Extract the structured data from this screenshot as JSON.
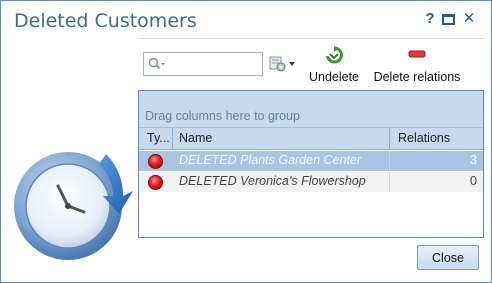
{
  "window": {
    "title": "Deleted Customers",
    "help_glyph": "?",
    "close_glyph": "✕"
  },
  "toolbar": {
    "search_value": "",
    "search_placeholder": "",
    "undelete_label": "Undelete",
    "delete_relations_label": "Delete relations"
  },
  "grid": {
    "group_panel_text": "Drag columns here to group",
    "columns": [
      "Ty...",
      "Name",
      "Relations"
    ],
    "rows": [
      {
        "type": "red-circle-icon",
        "name": "DELETED Plants Garden Center",
        "relations": "3",
        "selected": true
      },
      {
        "type": "red-circle-icon",
        "name": "DELETED Veronica's Flowershop",
        "relations": "0",
        "selected": false
      }
    ]
  },
  "footer": {
    "close_label": "Close"
  },
  "colors": {
    "accent": "#3a6aa5",
    "header_bg": "#c7d9ee",
    "selected_row": "#a9c4e4",
    "status_red": "#e02020"
  }
}
